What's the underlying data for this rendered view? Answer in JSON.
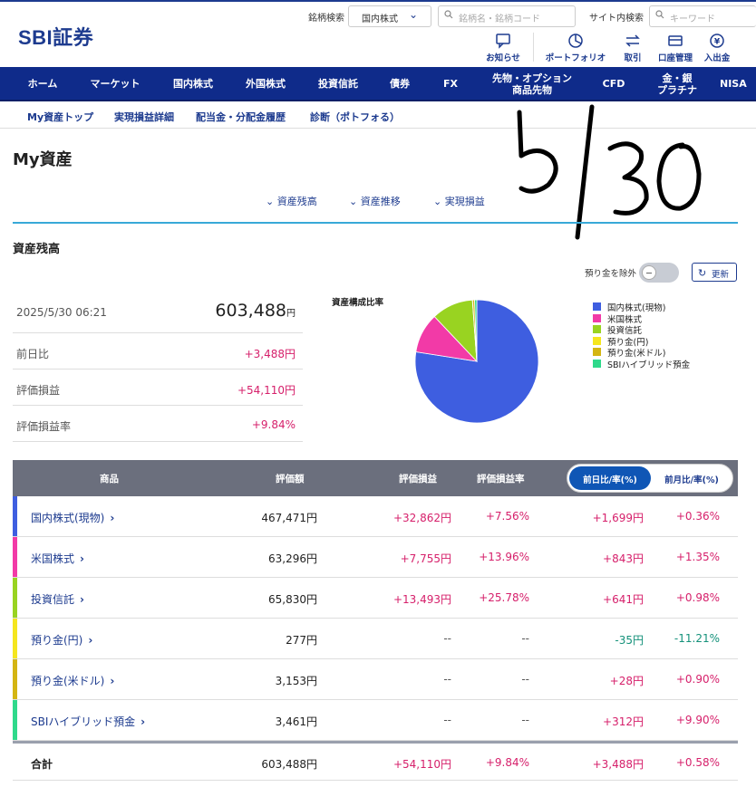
{
  "header": {
    "logo": "SBI証券",
    "stock_search_label": "銘柄検索",
    "stock_search_select": "国内株式",
    "stock_search_placeholder": "銘柄名・銘柄コード",
    "site_search_label": "サイト内検索",
    "site_search_placeholder": "キーワード",
    "icons": [
      {
        "label": "お知らせ",
        "icon": "chat-icon"
      },
      {
        "label": "ポートフォリオ",
        "icon": "portfolio-icon"
      },
      {
        "label": "取引",
        "icon": "trade-arrows-icon"
      },
      {
        "label": "口座管理",
        "icon": "account-card-icon"
      },
      {
        "label": "入出金",
        "icon": "yen-coin-icon"
      }
    ]
  },
  "nav": {
    "items": [
      "ホーム",
      "マーケット",
      "国内株式",
      "外国株式",
      "投資信託",
      "債券",
      "FX",
      "先物・オプション\n商品先物",
      "CFD",
      "金・銀\nプラチナ",
      "NISA"
    ]
  },
  "subnav": {
    "items": [
      "My資産トップ",
      "実現損益詳細",
      "配当金・分配金履歴",
      "診断（ポトフォる）"
    ]
  },
  "page": {
    "title": "My資産",
    "handwritten_note": "5/30",
    "tabs": [
      "資産残高",
      "資産推移",
      "実現損益"
    ],
    "section_title": "資産残高",
    "exclude_deposit_label": "預り金を除外",
    "exclude_deposit_on": false,
    "refresh_label": "更新"
  },
  "summary": {
    "datetime": "2025/5/30 06:21",
    "total_value": "603,488",
    "total_unit": "円",
    "rows": [
      {
        "label": "前日比",
        "value": "+3,488円"
      },
      {
        "label": "評価損益",
        "value": "+54,110円"
      },
      {
        "label": "評価損益率",
        "value": "+9.84%"
      }
    ]
  },
  "chart_data": {
    "type": "pie",
    "title": "資産構成比率",
    "categories": [
      "国内株式(現物)",
      "米国株式",
      "投資信託",
      "預り金(円)",
      "預り金(米ドル)",
      "SBIハイブリッド預金"
    ],
    "values": [
      467471,
      63296,
      65830,
      277,
      3153,
      3461
    ],
    "colors": [
      "#3e5ee0",
      "#f23aa7",
      "#99d321",
      "#f5e61e",
      "#d4b512",
      "#2fd98b"
    ]
  },
  "table": {
    "headers": {
      "product": "商品",
      "value": "評価額",
      "pl": "評価損益",
      "pl_rate": "評価損益率",
      "toggle_active": "前日比/率(%)",
      "toggle_inactive": "前月比/率(%)"
    },
    "rows": [
      {
        "name": "国内株式(現物)",
        "value": "467,471円",
        "pl": "+32,862円",
        "pl_rate": "+7.56%",
        "day_change": "+1,699円",
        "day_rate": "+0.36%",
        "color": "#3e5ee0",
        "pl_sign": "pos",
        "day_sign": "pos"
      },
      {
        "name": "米国株式",
        "value": "63,296円",
        "pl": "+7,755円",
        "pl_rate": "+13.96%",
        "day_change": "+843円",
        "day_rate": "+1.35%",
        "color": "#f23aa7",
        "pl_sign": "pos",
        "day_sign": "pos"
      },
      {
        "name": "投資信託",
        "value": "65,830円",
        "pl": "+13,493円",
        "pl_rate": "+25.78%",
        "day_change": "+641円",
        "day_rate": "+0.98%",
        "color": "#99d321",
        "pl_sign": "pos",
        "day_sign": "pos"
      },
      {
        "name": "預り金(円)",
        "value": "277円",
        "pl": "--",
        "pl_rate": "--",
        "day_change": "-35円",
        "day_rate": "-11.21%",
        "color": "#f5e61e",
        "pl_sign": "dash",
        "day_sign": "neg"
      },
      {
        "name": "預り金(米ドル)",
        "value": "3,153円",
        "pl": "--",
        "pl_rate": "--",
        "day_change": "+28円",
        "day_rate": "+0.90%",
        "color": "#d4b512",
        "pl_sign": "dash",
        "day_sign": "pos"
      },
      {
        "name": "SBIハイブリッド預金",
        "value": "3,461円",
        "pl": "--",
        "pl_rate": "--",
        "day_change": "+312円",
        "day_rate": "+9.90%",
        "color": "#2fd98b",
        "pl_sign": "dash",
        "day_sign": "pos"
      }
    ],
    "total": {
      "name": "合計",
      "value": "603,488円",
      "pl": "+54,110円",
      "pl_rate": "+9.84%",
      "day_change": "+3,488円",
      "day_rate": "+0.58%"
    }
  }
}
